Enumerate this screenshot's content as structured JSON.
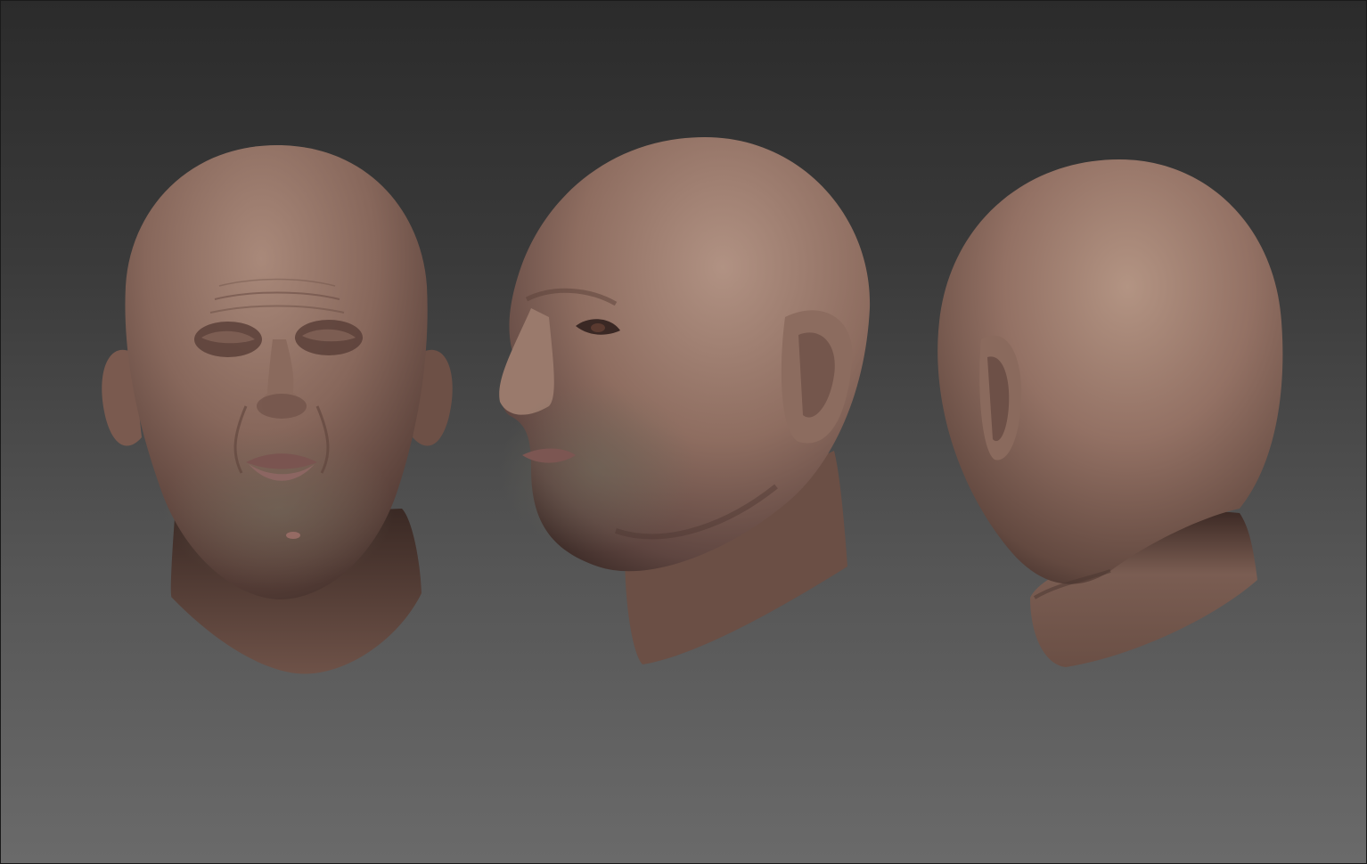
{
  "viewport": {
    "background_top": "#2b2b2b",
    "background_bottom": "#6a6a6a"
  },
  "models": [
    {
      "view": "front"
    },
    {
      "view": "three-quarter"
    },
    {
      "view": "back"
    }
  ],
  "skin_colors": {
    "highlight": "#a58575",
    "mid": "#7d5e53",
    "shadow": "#3f2c27",
    "beard_tint": "#6e6a5a",
    "lip": "#8c6662"
  }
}
